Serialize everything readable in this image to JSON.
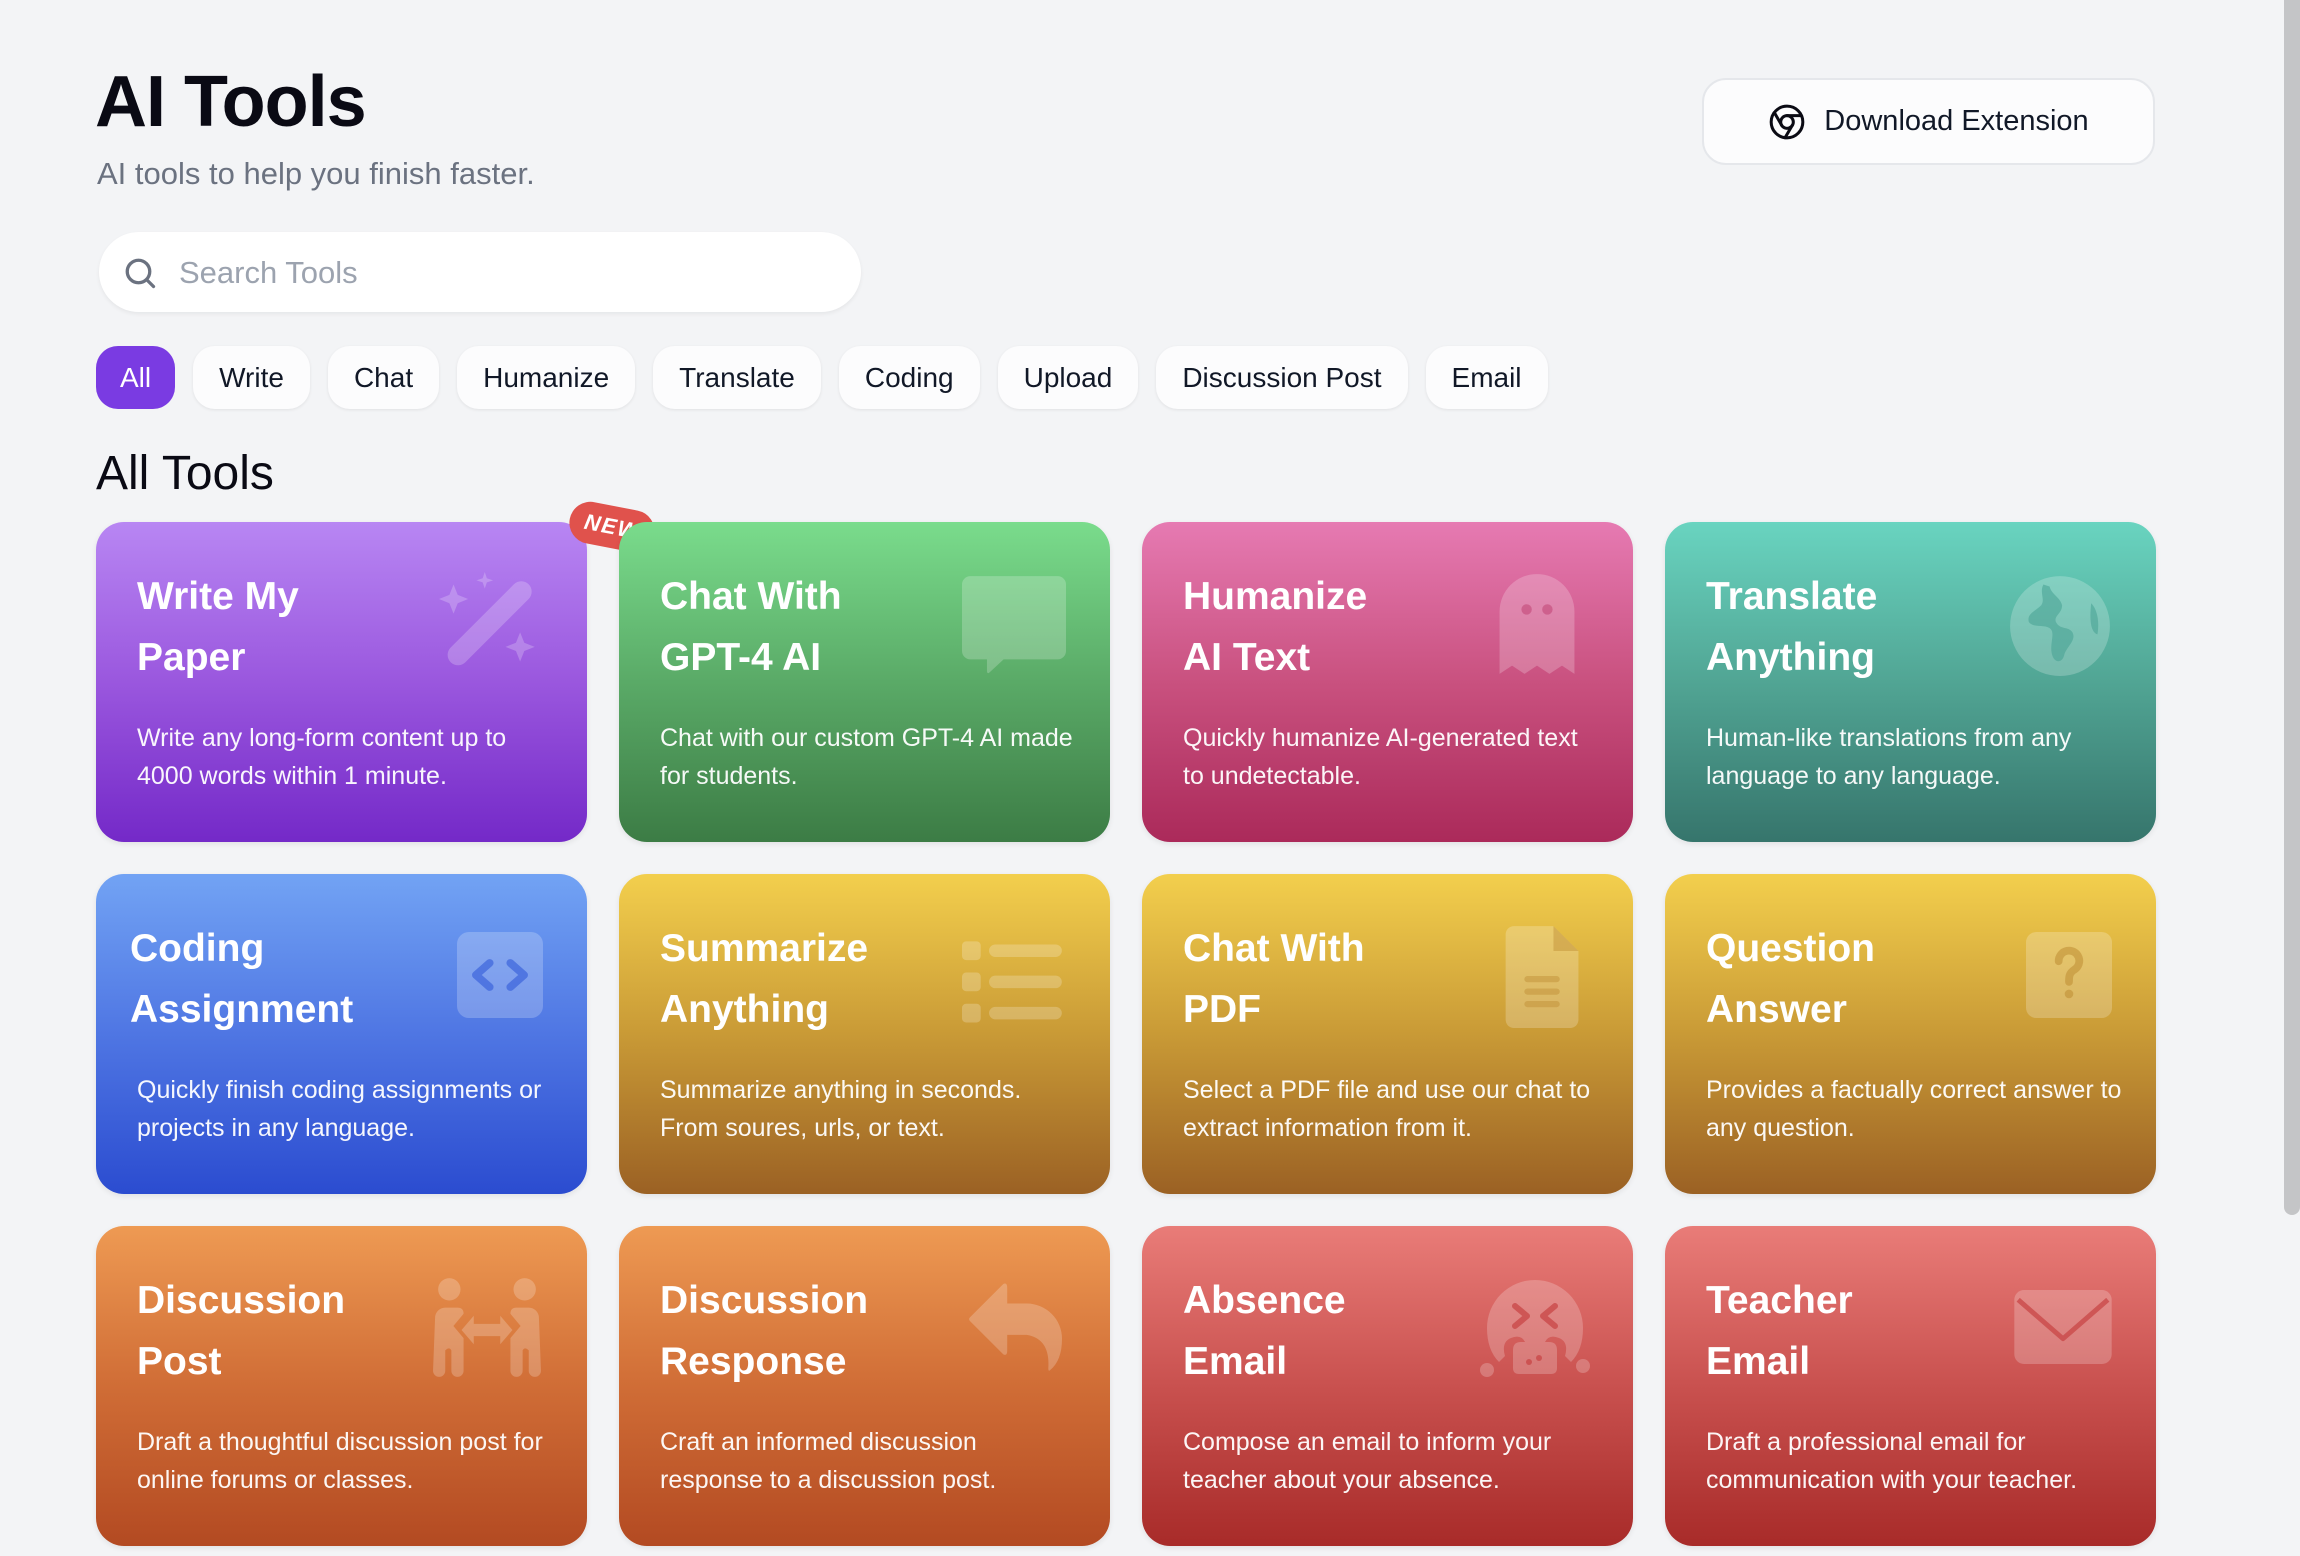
{
  "header": {
    "title": "AI Tools",
    "subtitle": "AI tools to help you finish faster.",
    "download_button": {
      "label": "Download Extension",
      "icon": "chrome-icon"
    }
  },
  "search": {
    "placeholder": "Search Tools",
    "value": "",
    "icon": "search-icon"
  },
  "filters": {
    "active": "All",
    "active_color": "#7a3be2",
    "items": [
      {
        "label": "All"
      },
      {
        "label": "Write"
      },
      {
        "label": "Chat"
      },
      {
        "label": "Humanize"
      },
      {
        "label": "Translate"
      },
      {
        "label": "Coding"
      },
      {
        "label": "Upload"
      },
      {
        "label": "Discussion Post"
      },
      {
        "label": "Email"
      }
    ]
  },
  "section": {
    "title": "All Tools"
  },
  "badge": {
    "new_label": "NEW",
    "color": "#e0524c"
  },
  "tools": [
    {
      "title": "Write My\nPaper",
      "description": "Write any long-form content up to 4000 words within 1 minute.",
      "icon": "magic-wand-icon",
      "color_top": "#b886f3",
      "color_bottom": "#7429c8",
      "is_new": true
    },
    {
      "title": "Chat With\nGPT-4 AI",
      "description": "Chat with our custom GPT-4 AI made for students.",
      "icon": "chat-bubble-icon",
      "color_top": "#7adc8c",
      "color_bottom": "#3c7c45"
    },
    {
      "title": "Humanize\nAI Text",
      "description": "Quickly humanize AI-generated text to undetectable.",
      "icon": "ghost-icon",
      "color_top": "#e67ab2",
      "color_bottom": "#ab2a5a"
    },
    {
      "title": "Translate\nAnything",
      "description": "Human-like translations from any language to any language.",
      "icon": "globe-icon",
      "color_top": "#69d4c0",
      "color_bottom": "#36756c"
    },
    {
      "title": "Coding\nAssignment",
      "description": "Quickly finish coding assignments or projects in any language.",
      "icon": "code-icon",
      "color_top": "#72a3f4",
      "color_bottom": "#2b4cd0"
    },
    {
      "title": "Summarize\nAnything",
      "description": "Summarize anything in seconds. From soures, urls, or text.",
      "icon": "list-icon",
      "color_top": "#f3cf4d",
      "color_bottom": "#9b6124"
    },
    {
      "title": "Chat With\nPDF",
      "description": "Select a PDF file and use our chat to extract information from it.",
      "icon": "document-icon",
      "color_top": "#f3cf4d",
      "color_bottom": "#9b6124"
    },
    {
      "title": "Question\nAnswer",
      "description": "Provides a factually correct answer to any question.",
      "icon": "question-icon",
      "color_top": "#f3cf4d",
      "color_bottom": "#9b6124"
    },
    {
      "title": "Discussion\nPost",
      "description": "Draft a thoughtful discussion post for online forums or classes.",
      "icon": "people-exchange-icon",
      "color_top": "#ee9a53",
      "color_bottom": "#b34a22"
    },
    {
      "title": "Discussion\nResponse",
      "description": "Craft an informed discussion response to a discussion post.",
      "icon": "reply-icon",
      "color_top": "#ee9a53",
      "color_bottom": "#b34a22"
    },
    {
      "title": "Absence\nEmail",
      "description": "Compose an email to inform your teacher about your absence.",
      "icon": "sick-face-icon",
      "color_top": "#e97c78",
      "color_bottom": "#a82b29"
    },
    {
      "title": "Teacher\nEmail",
      "description": "Draft a professional email for communication with your teacher.",
      "icon": "envelope-icon",
      "color_top": "#e97c78",
      "color_bottom": "#a82b29"
    }
  ]
}
